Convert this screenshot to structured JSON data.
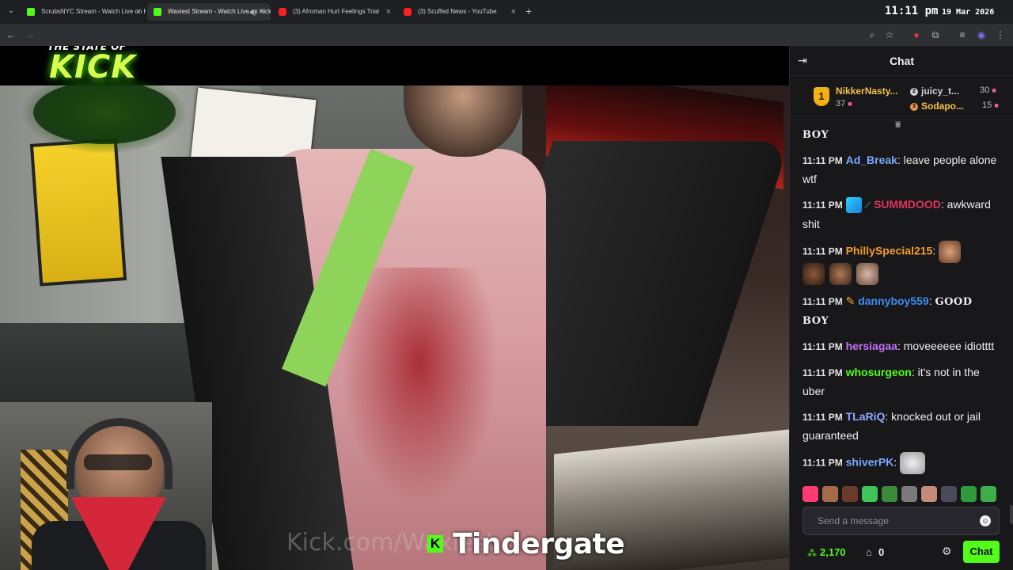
{
  "browser": {
    "tabs": [
      {
        "title": "ScrubsNYC Stream - Watch Live on Kick",
        "icon": "kick-favicon"
      },
      {
        "title": "Waxiest Stream - Watch Live on Kick",
        "icon": "kick-favicon",
        "active": true
      },
      {
        "title": "(3) Afroman Hurt Feelings Trial",
        "icon": "youtube-favicon"
      },
      {
        "title": "(3) Scuffed News - YouTube",
        "icon": "youtube-favicon"
      }
    ],
    "clock": "11:11 pm",
    "date": "19 Mar 2026"
  },
  "overlay": {
    "logo_top": "THE STATE OF",
    "logo_main": "KICK",
    "watermark": "Kick.com/Waxiest",
    "caption": "Tindergate",
    "caption_badge": "K"
  },
  "chat": {
    "title": "Chat",
    "gifters": [
      {
        "rank": "1",
        "name": "NikkerNasty...",
        "count": "37"
      },
      {
        "rank": "2",
        "name": "juicy_t...",
        "count": "30"
      },
      {
        "rank": "3",
        "name": "Sodapo...",
        "count": "15"
      }
    ],
    "messages": [
      {
        "time": "",
        "user": "",
        "text": "BOY",
        "color": "#efeff1",
        "serif": true
      },
      {
        "time": "11:11 PM",
        "user": "Ad_Break",
        "text": "leave people alone wtf",
        "color": "#7aa8ff"
      },
      {
        "time": "11:11 PM",
        "user": "SUMMDOOD",
        "text": "awkward shit",
        "color": "#e0345b"
      },
      {
        "time": "11:11 PM",
        "user": "PhillySpecial215",
        "text": "",
        "color": "#f59b2a"
      },
      {
        "time": "11:11 PM",
        "user": "dannyboy559",
        "text": "GOOD BOY",
        "color": "#3f8df0",
        "serif": true
      },
      {
        "time": "11:11 PM",
        "user": "hersiagaa",
        "text": "moveeeeee idiotttt",
        "color": "#c271f5"
      },
      {
        "time": "11:11 PM",
        "user": "whosurgeon",
        "text": "it's not in the uber",
        "color": "#53fc18"
      },
      {
        "time": "11:11 PM",
        "user": "TLaRiQ",
        "text": "knocked out or jail guaranteed",
        "color": "#8fa8ff"
      },
      {
        "time": "11:11 PM",
        "user": "shiverPK",
        "text": "",
        "color": "#7aa8ff"
      }
    ],
    "input_placeholder": "Send a message",
    "points": "2,170",
    "store_count": "0",
    "send_label": "Chat"
  },
  "colors": {
    "kick_green": "#53fc18",
    "chat_bg": "#18181b"
  }
}
